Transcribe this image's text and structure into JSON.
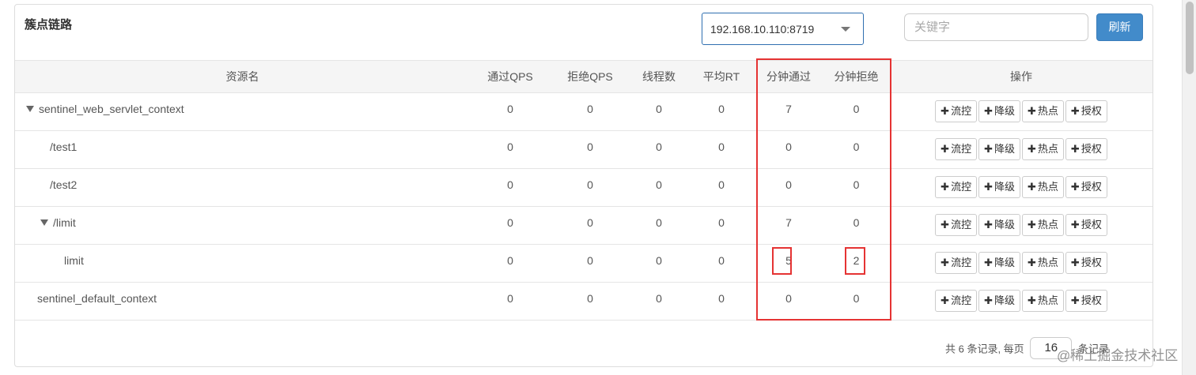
{
  "panel": {
    "title": "簇点链路"
  },
  "toolbar": {
    "machine_selected": "192.168.10.110:8719",
    "search_placeholder": "关键字",
    "refresh_label": "刷新"
  },
  "table": {
    "headers": [
      "资源名",
      "通过QPS",
      "拒绝QPS",
      "线程数",
      "平均RT",
      "分钟通过",
      "分钟拒绝",
      "操作"
    ],
    "rows": [
      {
        "name": "sentinel_web_servlet_context",
        "pass_qps": "0",
        "block_qps": "0",
        "threads": "0",
        "avg_rt": "0",
        "min_pass": "7",
        "min_block": "0"
      },
      {
        "name": "/test1",
        "pass_qps": "0",
        "block_qps": "0",
        "threads": "0",
        "avg_rt": "0",
        "min_pass": "0",
        "min_block": "0"
      },
      {
        "name": "/test2",
        "pass_qps": "0",
        "block_qps": "0",
        "threads": "0",
        "avg_rt": "0",
        "min_pass": "0",
        "min_block": "0"
      },
      {
        "name": "/limit",
        "pass_qps": "0",
        "block_qps": "0",
        "threads": "0",
        "avg_rt": "0",
        "min_pass": "7",
        "min_block": "0"
      },
      {
        "name": "limit",
        "pass_qps": "0",
        "block_qps": "0",
        "threads": "0",
        "avg_rt": "0",
        "min_pass": "5",
        "min_block": "2"
      },
      {
        "name": "sentinel_default_context",
        "pass_qps": "0",
        "block_qps": "0",
        "threads": "0",
        "avg_rt": "0",
        "min_pass": "0",
        "min_block": "0"
      }
    ],
    "actions": {
      "flow": "流控",
      "degrade": "降级",
      "hotspot": "热点",
      "auth": "授权"
    }
  },
  "pager": {
    "total_text": "共 6 条记录, 每页",
    "page_size": "16",
    "suffix": "条记录"
  },
  "watermark": "@稀土掘金技术社区",
  "colors": {
    "primary": "#428bca",
    "highlight": "#e53333",
    "header_bg": "#f5f5f5"
  }
}
